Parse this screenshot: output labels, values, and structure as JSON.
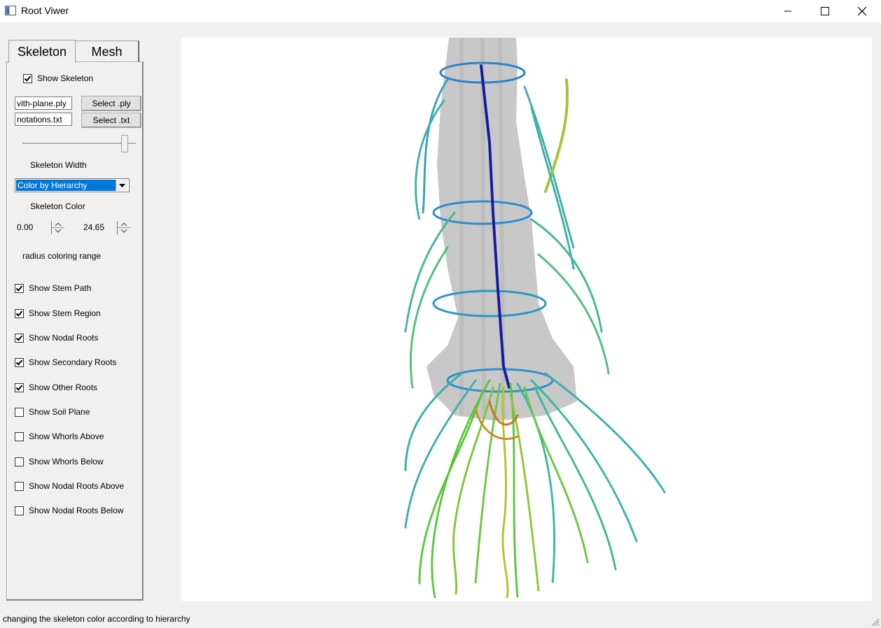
{
  "window": {
    "title": "Root Viwer"
  },
  "tabs": [
    {
      "label": "Skeleton"
    },
    {
      "label": "Mesh"
    }
  ],
  "skeleton": {
    "show_skeleton": {
      "label": "Show Skeleton",
      "checked": true
    },
    "ply_file": "vith-plane.ply",
    "txt_file": "notations.txt",
    "select_ply_label": "Select .ply",
    "select_txt_label": "Select .txt",
    "width_slider_value": 0.9,
    "width_label": "Skeleton Width",
    "color_mode": "Color by Hierarchy",
    "color_label": "Skeleton Color",
    "range_min": "0.00",
    "range_max": "24.65",
    "range_label": "radius coloring range",
    "options": [
      {
        "label": "Show Stem Path",
        "checked": true
      },
      {
        "label": "Show Stem Region",
        "checked": true
      },
      {
        "label": "Show Nodal Roots",
        "checked": true
      },
      {
        "label": "Show Secondary Roots",
        "checked": true
      },
      {
        "label": "Show Other Roots",
        "checked": true
      },
      {
        "label": "Show Soil Plane",
        "checked": false
      },
      {
        "label": "Show Whorls Above",
        "checked": false
      },
      {
        "label": "Show Whorls Below",
        "checked": false
      },
      {
        "label": "Show Nodal Roots Above",
        "checked": false
      },
      {
        "label": "Show Nodal Roots Below",
        "checked": false
      }
    ]
  },
  "status_bar": {
    "text": "changing the skeleton color according to hierarchy"
  },
  "colors": {
    "selection": "#0078d7",
    "stem_path": "#1a1aa0",
    "root_blue": "#2a7fd0",
    "root_teal": "#2fb0a0",
    "root_green": "#5ac83a",
    "root_yellow": "#b8c030",
    "root_orange": "#d07020",
    "mesh": "#c8c8c8"
  }
}
